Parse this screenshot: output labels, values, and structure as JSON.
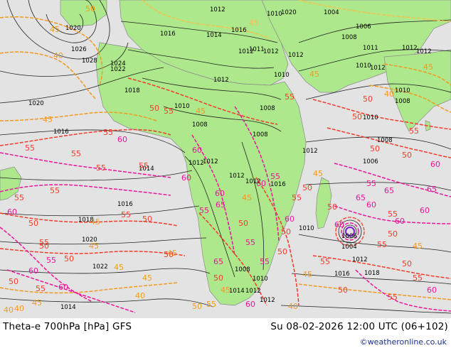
{
  "map": {
    "colors": {
      "ocean": "#e3e3e3",
      "land": "#aee88c",
      "isobar": "#202020",
      "theta_orange": "#f29a1e",
      "theta_light": "#f5c24a",
      "theta_red": "#f23c2a",
      "theta_magenta": "#e8169a",
      "theta_purple": "#7a1fd6",
      "coastline": "#8a8a8a"
    },
    "isobar_labels": [
      "1012",
      "1020",
      "1016",
      "1010",
      "1014",
      "1020",
      "1026",
      "1028",
      "1024",
      "1022",
      "1018",
      "1016",
      "1012",
      "1020",
      "1016",
      "1012",
      "1010",
      "1008",
      "1010",
      "1011",
      "1012",
      "1012",
      "1008",
      "1004",
      "1006",
      "1008",
      "1012",
      "1011",
      "1010",
      "1012",
      "1012",
      "1010",
      "1008",
      "1014",
      "1012",
      "1012",
      "1012",
      "1016",
      "1018",
      "1020",
      "1022",
      "1014",
      "1008",
      "1012",
      "1016",
      "1012",
      "1010",
      "1008",
      "1006",
      "1016",
      "1018",
      "1012",
      "1004",
      "1006",
      "1010",
      "1012",
      "1010",
      "1012",
      "1008",
      "1014"
    ],
    "theta_labels": [
      "40",
      "45",
      "50",
      "45",
      "40",
      "45",
      "40",
      "45",
      "55",
      "45",
      "50",
      "55",
      "50",
      "45",
      "55",
      "60",
      "50",
      "55",
      "55",
      "50",
      "50",
      "55",
      "45",
      "55",
      "60",
      "55",
      "60",
      "55",
      "45",
      "55",
      "60",
      "55",
      "50",
      "45",
      "60",
      "55",
      "50",
      "55",
      "60",
      "65",
      "55",
      "50",
      "60",
      "55",
      "65",
      "60",
      "50",
      "60",
      "65",
      "55",
      "60",
      "55",
      "50",
      "55",
      "50",
      "45",
      "65",
      "60",
      "50",
      "55",
      "60",
      "50",
      "45",
      "40",
      "45",
      "50",
      "55",
      "60",
      "65",
      "55",
      "50",
      "60",
      "45",
      "40",
      "45",
      "50",
      "55",
      "60",
      "55",
      "50",
      "45",
      "50",
      "55",
      "60",
      "55",
      "50",
      "45",
      "50",
      "55",
      "50",
      "45",
      "40"
    ]
  },
  "footer": {
    "left_text": "Theta-e 700hPa [hPa] GFS",
    "right_text": "Su 08-02-2026 12:00 UTC (06+102)",
    "credit": "©weatheronline.co.uk"
  }
}
